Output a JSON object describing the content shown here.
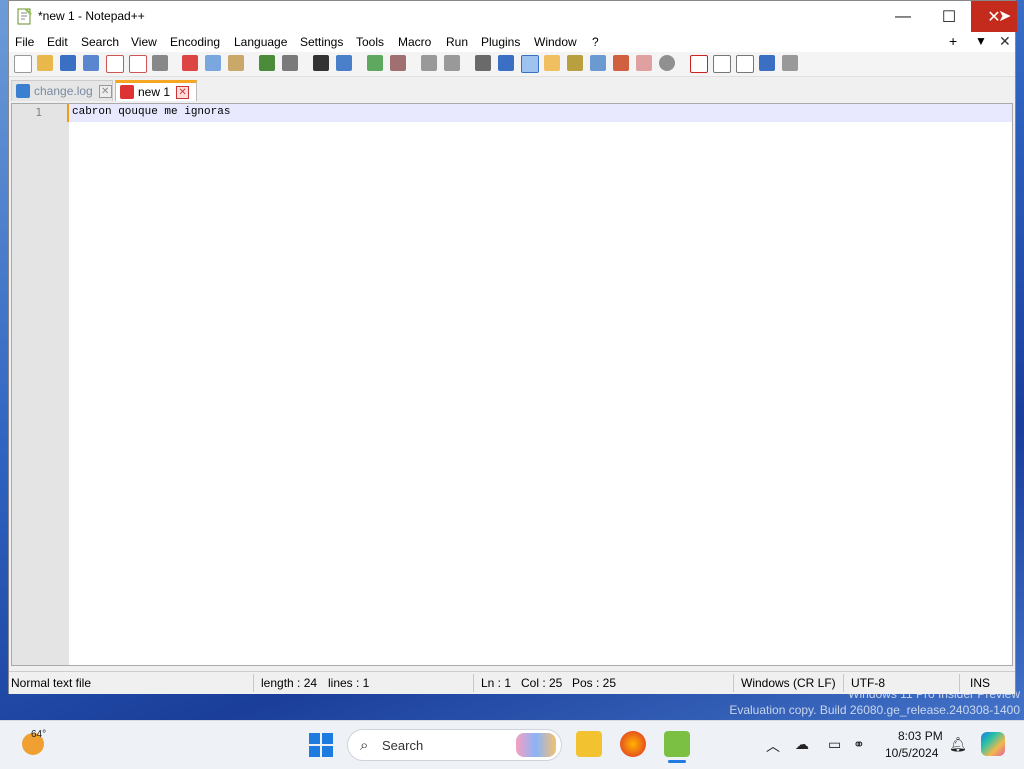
{
  "window": {
    "title": "*new 1 - Notepad++",
    "controls": {
      "minimize": "—",
      "maximize": "☐",
      "close": "✕"
    }
  },
  "menu": {
    "items": [
      "File",
      "Edit",
      "Search",
      "View",
      "Encoding",
      "Language",
      "Settings",
      "Tools",
      "Macro",
      "Run",
      "Plugins",
      "Window",
      "?"
    ],
    "right_add": "+",
    "right_down": "▼",
    "right_close": "✕"
  },
  "tabs": [
    {
      "label": "change.log",
      "icon": "save-icon-blue",
      "active": false
    },
    {
      "label": "new 1",
      "icon": "save-icon-red",
      "active": true
    }
  ],
  "editor": {
    "line_number": "1",
    "content": "cabron qouque me ignoras"
  },
  "status": {
    "file_type": "Normal text file",
    "length": "length : 24",
    "lines": "lines : 1",
    "ln": "Ln : 1",
    "col": "Col : 25",
    "pos": "Pos : 25",
    "eol": "Windows (CR LF)",
    "encoding": "UTF-8",
    "mode": "INS"
  },
  "watermark": {
    "line1": "Windows 11 Pro Insider Preview",
    "line2": "Evaluation copy. Build 26080.ge_release.240308-1400"
  },
  "taskbar": {
    "weather_temp": "64°",
    "search_placeholder": "Search",
    "clock_time": "8:03 PM",
    "clock_date": "10/5/2024"
  },
  "colors": {
    "close_button": "#c42b1c",
    "active_tab_accent": "#f5a623",
    "current_line": "#e8e8ff"
  }
}
